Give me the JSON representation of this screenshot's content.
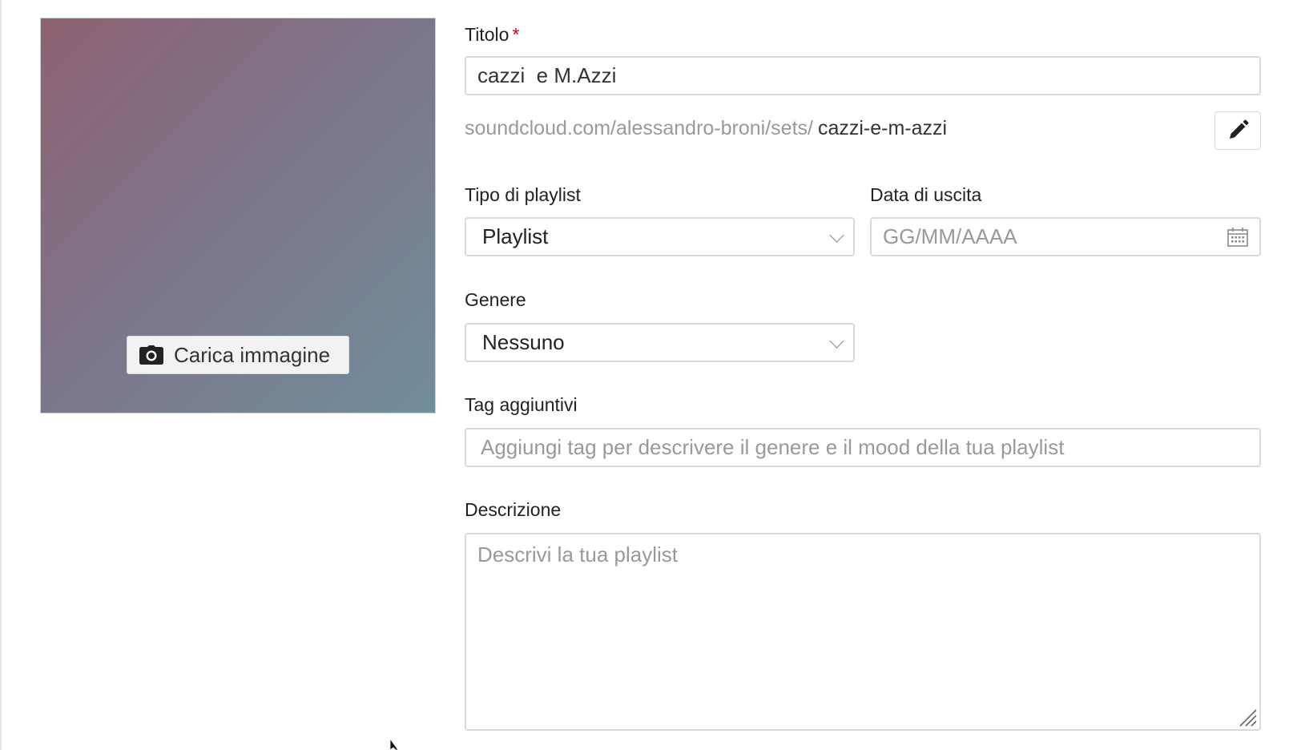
{
  "artwork": {
    "upload_label": "Carica immagine",
    "gradient_colors": [
      "#8e6272",
      "#7d7488",
      "#718e9b"
    ]
  },
  "title_field": {
    "label": "Titolo",
    "required_marker": "*",
    "value": "cazzi  e M.Azzi"
  },
  "permalink": {
    "base": "soundcloud.com/alessandro-broni/sets/",
    "slug": "cazzi-e-m-azzi",
    "edit_icon": "pencil-icon"
  },
  "playlist_type": {
    "label": "Tipo di playlist",
    "selected": "Playlist"
  },
  "release_date": {
    "label": "Data di uscita",
    "placeholder": "GG/MM/AAAA",
    "icon": "calendar-icon"
  },
  "genre": {
    "label": "Genere",
    "selected": "Nessuno"
  },
  "tags": {
    "label": "Tag aggiuntivi",
    "placeholder": "Aggiungi tag per descrivere il genere e il mood della tua playlist"
  },
  "description": {
    "label": "Descrizione",
    "placeholder": "Descrivi la tua playlist"
  },
  "colors": {
    "required": "#d0021b",
    "border": "#d9d9d9",
    "muted_text": "#999999"
  }
}
